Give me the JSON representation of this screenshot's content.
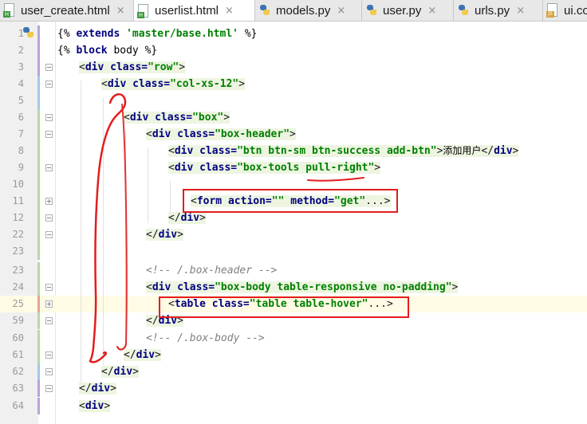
{
  "tabs": [
    {
      "label": "user_create.html",
      "icon": "html-file-icon",
      "active": false
    },
    {
      "label": "userlist.html",
      "icon": "html-file-icon",
      "active": true
    },
    {
      "label": "models.py",
      "icon": "python-file-icon",
      "active": false
    },
    {
      "label": "user.py",
      "icon": "python-file-icon",
      "active": false
    },
    {
      "label": "urls.py",
      "icon": "python-file-icon",
      "active": false
    },
    {
      "label": "ui.co",
      "icon": "js-file-icon",
      "active": false
    }
  ],
  "tab_close_glyph": "×",
  "file_badges": {
    "html": "H",
    "js": "JS"
  },
  "lines": [
    {
      "num": "1",
      "text": "{% extends 'master/base.html' %}"
    },
    {
      "num": "2",
      "text": "{% block body %}"
    },
    {
      "num": "3",
      "text": "<div class=\"row\">"
    },
    {
      "num": "4",
      "text": "<div class=\"col-xs-12\">"
    },
    {
      "num": "5",
      "text": ""
    },
    {
      "num": "6",
      "text": "<div class=\"box\">"
    },
    {
      "num": "7",
      "text": "<div class=\"box-header\">"
    },
    {
      "num": "8",
      "text": "<div class=\"btn btn-sm btn-success add-btn\">添加用户</div>"
    },
    {
      "num": "9",
      "text": "<div class=\"box-tools pull-right\">"
    },
    {
      "num": "10",
      "text": ""
    },
    {
      "num": "11",
      "text": "<form action=\"\" method=\"get\"...>"
    },
    {
      "num": "12",
      "text": "</div>"
    },
    {
      "num": "22",
      "text": "</div>"
    },
    {
      "num": "23",
      "text": ""
    },
    {
      "num": "23",
      "text": "<!-- /.box-header -->"
    },
    {
      "num": "24",
      "text": "<div class=\"box-body table-responsive no-padding\">"
    },
    {
      "num": "25",
      "text": "<table class=\"table table-hover\"...>"
    },
    {
      "num": "59",
      "text": "</div>"
    },
    {
      "num": "60",
      "text": "<!-- /.box-body -->"
    },
    {
      "num": "61",
      "text": "</div>"
    },
    {
      "num": "62",
      "text": "</div>"
    },
    {
      "num": "63",
      "text": "</div>"
    },
    {
      "num": "64",
      "text": "<div>"
    }
  ],
  "tokens": {
    "l1a": "{% ",
    "l1b": "extends",
    "l1c": " 'master/base.html'",
    "l1d": " %}",
    "l2a": "{% ",
    "l2b": "block",
    "l2c": " body",
    "l2d": " %}",
    "lt": "<",
    "gt": ">",
    "ltslash": "</",
    "ellgt": "...>",
    "div": "div",
    "form": "form",
    "table": "table",
    "cls": " class=",
    "act": " action=",
    "meth": " method=",
    "v_row": "\"row\"",
    "v_col": "\"col-xs-12\"",
    "v_box": "\"box\"",
    "v_boxh": "\"box-header\"",
    "v_btn": "\"btn btn-sm btn-success add-btn\"",
    "btn_text": "添加用户",
    "v_tools": "\"box-tools pull-right\"",
    "v_empty": "\"\"",
    "v_get": "\"get\"",
    "v_body": "\"box-body table-responsive no-padding\"",
    "v_table": "\"table table-hover\"",
    "c_header": "<!-- /.box-header -->",
    "c_body": "<!-- /.box-body -->"
  },
  "colors": {
    "annotation": "#e21d1d",
    "keyword": "#000080",
    "string": "#008000",
    "comment": "#808080",
    "caret_line": "#fffbe5"
  }
}
